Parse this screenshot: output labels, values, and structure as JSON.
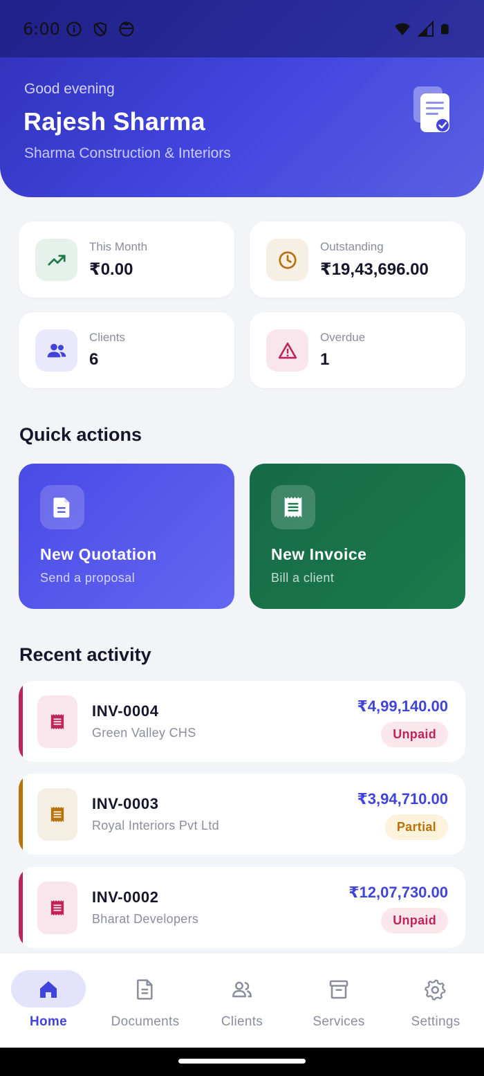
{
  "status_bar": {
    "time": "6:00"
  },
  "header": {
    "greeting": "Good evening",
    "user_name": "Rajesh Sharma",
    "company": "Sharma Construction & Interiors",
    "logo_icon": "document-check-icon"
  },
  "stats": [
    {
      "label": "This Month",
      "value": "₹0.00",
      "icon": "trending-up-icon",
      "icon_color": "#1f7a4a",
      "bg": "#e6f1ec"
    },
    {
      "label": "Outstanding",
      "value": "₹19,43,696.00",
      "icon": "clock-icon",
      "icon_color": "#b8720a",
      "bg": "#f6efe3"
    },
    {
      "label": "Clients",
      "value": "6",
      "icon": "users-icon",
      "icon_color": "#4144d8",
      "bg": "#e9e9fb"
    },
    {
      "label": "Overdue",
      "value": "1",
      "icon": "warning-icon",
      "icon_color": "#c0225a",
      "bg": "#f9e6ec"
    }
  ],
  "quick_actions": {
    "title": "Quick actions",
    "items": [
      {
        "title": "New Quotation",
        "subtitle": "Send a proposal",
        "icon": "document-icon"
      },
      {
        "title": "New Invoice",
        "subtitle": "Bill a client",
        "icon": "receipt-icon"
      }
    ]
  },
  "recent_activity": {
    "title": "Recent activity",
    "items": [
      {
        "id": "INV-0004",
        "client": "Green Valley CHS",
        "amount": "₹4,99,140.00",
        "status": "Unpaid",
        "accent": "#c0225a",
        "icon_bg": "#f9e6ec",
        "badge_bg": "#fbe6ec",
        "badge_color": "#c0225a"
      },
      {
        "id": "INV-0003",
        "client": "Royal Interiors Pvt Ltd",
        "amount": "₹3,94,710.00",
        "status": "Partial",
        "accent": "#b8720a",
        "icon_bg": "#f5efe3",
        "badge_bg": "#fdf2dc",
        "badge_color": "#b8720a"
      },
      {
        "id": "INV-0002",
        "client": "Bharat Developers",
        "amount": "₹12,07,730.00",
        "status": "Unpaid",
        "accent": "#c0225a",
        "icon_bg": "#f9e6ec",
        "badge_bg": "#fbe6ec",
        "badge_color": "#c0225a"
      }
    ]
  },
  "bottom_nav": [
    {
      "label": "Home",
      "icon": "home-icon",
      "active": true
    },
    {
      "label": "Documents",
      "icon": "document-icon",
      "active": false
    },
    {
      "label": "Clients",
      "icon": "users-icon",
      "active": false
    },
    {
      "label": "Services",
      "icon": "archive-box-icon",
      "active": false
    },
    {
      "label": "Settings",
      "icon": "gear-icon",
      "active": false
    }
  ],
  "colors": {
    "primary": "#4144d8",
    "hero_start": "#2f2fb8",
    "hero_end": "#5a5fe2",
    "invoice_green": "#1a7a4a"
  }
}
